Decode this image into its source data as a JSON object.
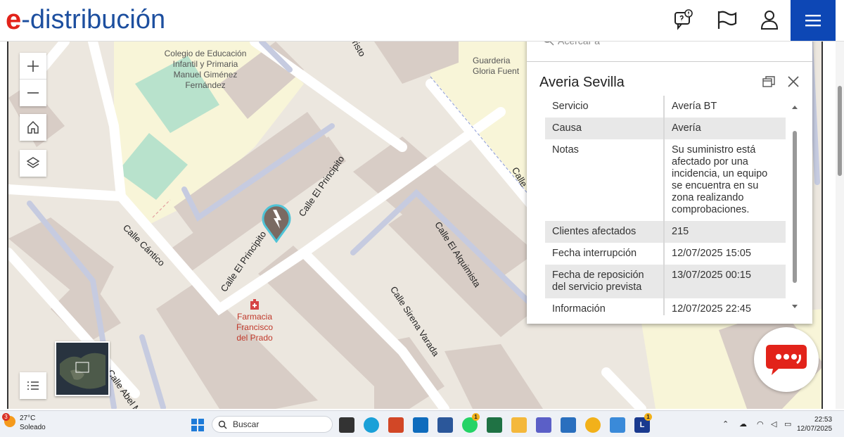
{
  "header": {
    "logo_e": "e",
    "logo_text": "-distribución",
    "icons": [
      "chat-alert-icon",
      "flag-icon",
      "user-icon",
      "menu-icon"
    ]
  },
  "map": {
    "labels": {
      "school": "Colegio de Educación\nInfantil y Primaria\nManuel Giménez\nFernández",
      "daycare": "Guarderia\nGloria Fuent",
      "pharmacy": "Farmacia\nFrancisco\ndel Prado"
    },
    "streets": {
      "principito_a": "Calle El Principito",
      "principito_b": "Calle El Principito",
      "cantico": "Calle Cántico",
      "alquimista": "Calle El Alquimista",
      "sirena": "Calle Sirena Varada",
      "abel": "Calle Abel M",
      "risto": "risto",
      "c_top": "Calle"
    },
    "controls": [
      "zoom-in-icon",
      "zoom-out-icon",
      "home-icon",
      "layers-icon",
      "list-icon"
    ]
  },
  "popup": {
    "search_placeholder": "Acercar a",
    "title": "Averia Sevilla",
    "rows": [
      {
        "key": "Servicio",
        "value": "Avería BT"
      },
      {
        "key": "Causa",
        "value": "Avería"
      },
      {
        "key": "Notas",
        "value": "Su suministro está afectado por una incidencia, un equipo se encuentra en su zona realizando comprobaciones."
      },
      {
        "key": "Clientes afectados",
        "value": "215"
      },
      {
        "key": "Fecha interrupción",
        "value": "12/07/2025 15:05"
      },
      {
        "key": "Fecha de reposición del servicio prevista",
        "value": "13/07/2025 00:15"
      },
      {
        "key": "Información",
        "value": "12/07/2025 22:45"
      }
    ]
  },
  "taskbar": {
    "weather_badge": "3",
    "temperature": "27°C",
    "weather_desc": "Soleado",
    "search_label": "Buscar",
    "time": "22:53",
    "date": "12/07/2025",
    "whatsapp_badge": "1",
    "l_badge": "1",
    "l_letter": "L"
  },
  "colors": {
    "brand_blue": "#1d4f9f",
    "brand_red": "#e2231a",
    "menu_blue": "#0d47b5",
    "marker": "#7a6a62",
    "marker_ring": "#4fc3d6"
  }
}
